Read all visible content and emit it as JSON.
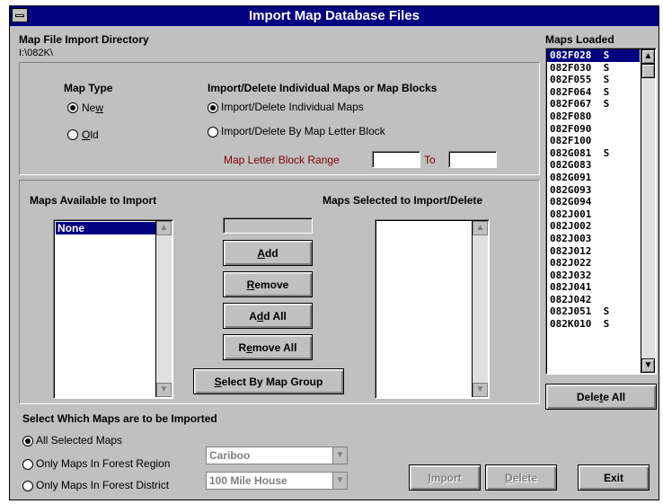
{
  "window": {
    "title": "Import Map Database Files"
  },
  "directory": {
    "label": "Map File Import Directory",
    "path": "I:\\082K\\"
  },
  "map_type": {
    "label": "Map Type",
    "options": [
      {
        "label": "New",
        "selected": true
      },
      {
        "label": "Old",
        "selected": false
      }
    ]
  },
  "import_mode": {
    "label": "Import/Delete Individual Maps or Map Blocks",
    "options": [
      {
        "label": "Import/Delete Individual Maps",
        "selected": true
      },
      {
        "label": "Import/Delete By Map Letter Block",
        "selected": false
      }
    ],
    "range_label": "Map Letter Block Range",
    "range_to": "To",
    "range_from_value": "",
    "range_to_value": ""
  },
  "available": {
    "label": "Maps Available to Import",
    "items": [
      "None"
    ]
  },
  "selected_maps": {
    "label": "Maps Selected to Import/Delete",
    "items": []
  },
  "middle": {
    "status_value": "",
    "add": "Add",
    "remove": "Remove",
    "add_all": "Add All",
    "remove_all": "Remove All",
    "select_group": "Select By Map Group"
  },
  "loaded": {
    "label": "Maps Loaded",
    "items": [
      "082F028  S",
      "082F030  S",
      "082F055  S",
      "082F064  S",
      "082F067  S",
      "082F080",
      "082F090",
      "082F100",
      "082G081  S",
      "082G083",
      "082G091",
      "082G093",
      "082G094",
      "082J001",
      "082J002",
      "082J003",
      "082J012",
      "082J022",
      "082J032",
      "082J041",
      "082J042",
      "082J051  S",
      "082K010  S"
    ],
    "delete_all": "Delete All"
  },
  "which": {
    "label": "Select Which Maps are to be Imported",
    "options": [
      {
        "label": "All Selected Maps",
        "selected": true
      },
      {
        "label": "Only Maps In Forest Region",
        "selected": false
      },
      {
        "label": "Only Maps In Forest District",
        "selected": false
      }
    ],
    "region_value": "Cariboo",
    "district_value": "100 Mile House"
  },
  "footer": {
    "import": "Import",
    "delete": "Delete",
    "exit": "Exit"
  },
  "colors": {
    "title_bg": "#000080",
    "face": "#c0c0c0",
    "range_label": "#800000"
  }
}
